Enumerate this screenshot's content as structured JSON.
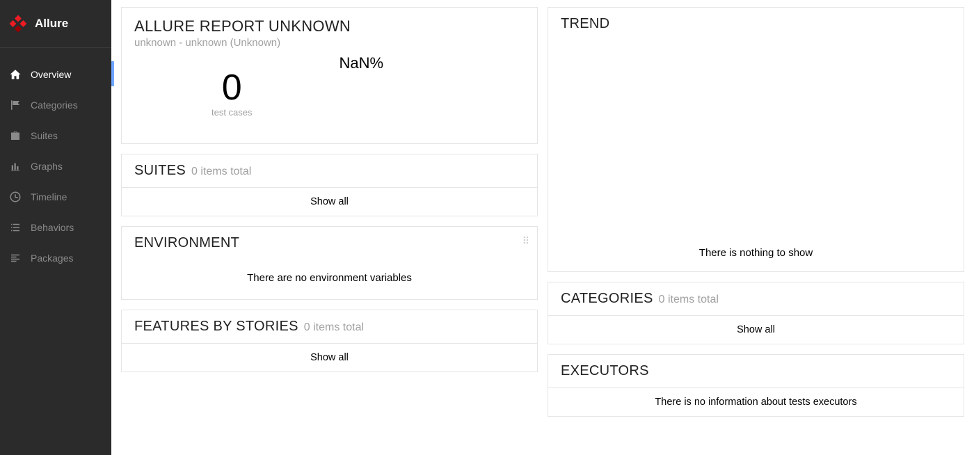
{
  "brand": {
    "name": "Allure"
  },
  "nav": {
    "items": [
      {
        "label": "Overview"
      },
      {
        "label": "Categories"
      },
      {
        "label": "Suites"
      },
      {
        "label": "Graphs"
      },
      {
        "label": "Timeline"
      },
      {
        "label": "Behaviors"
      },
      {
        "label": "Packages"
      }
    ]
  },
  "summary": {
    "title": "ALLURE REPORT UNKNOWN",
    "subtitle": "unknown - unknown (Unknown)",
    "percent": "NaN%",
    "count": "0",
    "count_label": "test cases"
  },
  "suites": {
    "title": "SUITES",
    "items_total": "0 items total",
    "show_all": "Show all"
  },
  "environment": {
    "title": "ENVIRONMENT",
    "message": "There are no environment variables"
  },
  "features": {
    "title": "FEATURES BY STORIES",
    "items_total": "0 items total",
    "show_all": "Show all"
  },
  "trend": {
    "title": "TREND",
    "message": "There is nothing to show"
  },
  "categories_w": {
    "title": "CATEGORIES",
    "items_total": "0 items total",
    "show_all": "Show all"
  },
  "executors": {
    "title": "EXECUTORS",
    "message": "There is no information about tests executors"
  }
}
